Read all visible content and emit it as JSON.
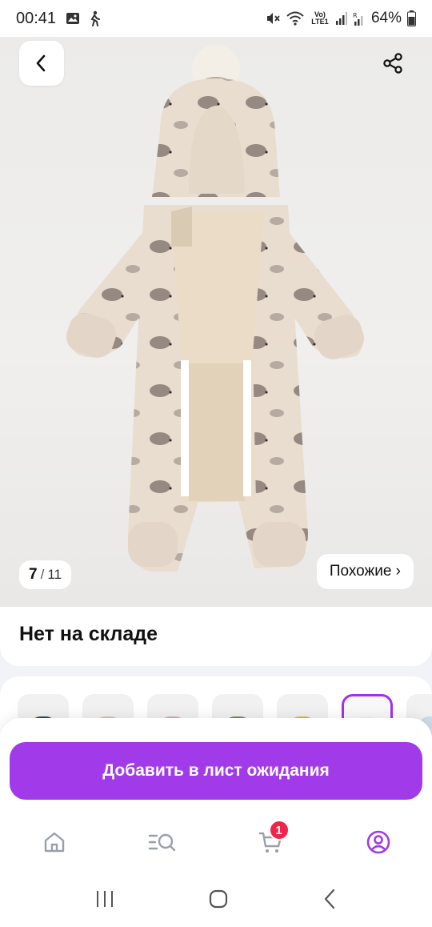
{
  "status_bar": {
    "time": "00:41",
    "battery": "64%",
    "left_icons": [
      "gallery-icon",
      "walking-icon"
    ],
    "right_icons": [
      "mute-icon",
      "wifi-icon",
      "volte-icon",
      "signal-icon",
      "signal-roaming-icon",
      "battery-icon"
    ],
    "network_label": "Vo) LTE1"
  },
  "product_gallery": {
    "current": "7",
    "separator": "/",
    "total": "11",
    "similar_label": "Похожие ›"
  },
  "stock": {
    "status": "Нет на складе"
  },
  "variants": {
    "colors": [
      "#2d4a5c",
      "#d6c2b3",
      "#ef9cc4",
      "#6f8e6a",
      "#e8b530",
      "#f4f1ea",
      "#cfdbe6"
    ],
    "selected_index": 5
  },
  "cta": {
    "label": "Добавить в лист ожидания",
    "color": "#a13bea"
  },
  "tabbar": {
    "items": [
      "home-icon",
      "catalog-search-icon",
      "cart-icon",
      "profile-icon"
    ],
    "cart_badge": "1",
    "active_color": "#a13bea"
  },
  "system_nav": {
    "items": [
      "recent-apps-icon",
      "home-circle-icon",
      "back-icon"
    ]
  }
}
